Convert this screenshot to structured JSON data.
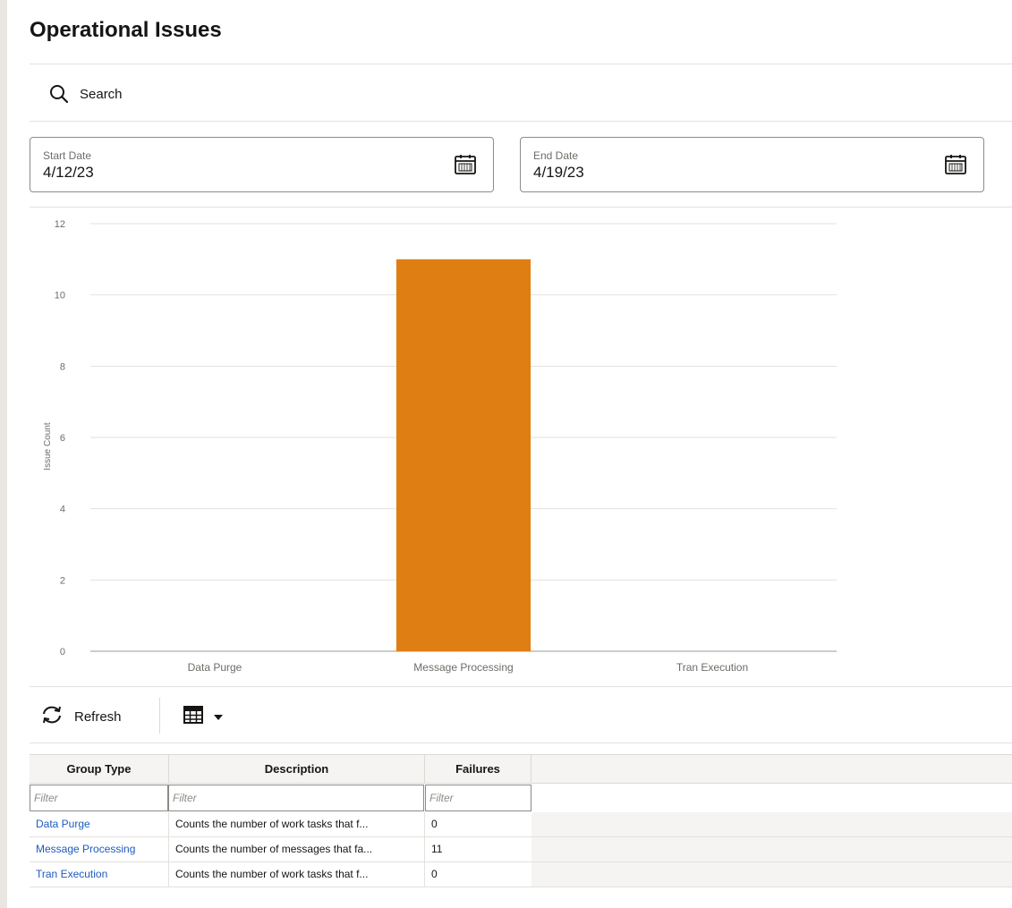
{
  "page": {
    "title": "Operational Issues"
  },
  "search": {
    "label": "Search"
  },
  "filters": {
    "start": {
      "label": "Start Date",
      "value": "4/12/23"
    },
    "end": {
      "label": "End Date",
      "value": "4/19/23"
    }
  },
  "chart_data": {
    "type": "bar",
    "categories": [
      "Data Purge",
      "Message Processing",
      "Tran Execution"
    ],
    "values": [
      0,
      11,
      0
    ],
    "ylabel": "Issue Count",
    "xlabel": "",
    "ylim": [
      0,
      12
    ],
    "yticks": [
      0,
      2,
      4,
      6,
      8,
      10,
      12
    ],
    "grid": true,
    "bar_color": "#df7e13"
  },
  "toolbar": {
    "refresh_label": "Refresh"
  },
  "table": {
    "columns": [
      "Group Type",
      "Description",
      "Failures"
    ],
    "filter_placeholder": "Filter",
    "rows": [
      {
        "group": "Data Purge",
        "description": "Counts the number of work tasks that f...",
        "failures": "0"
      },
      {
        "group": "Message Processing",
        "description": "Counts the number of messages that fa...",
        "failures": "11"
      },
      {
        "group": "Tran Execution",
        "description": "Counts the number of work tasks that f...",
        "failures": "0"
      }
    ]
  },
  "colors": {
    "accent": "#df7e13",
    "link": "#1d5bbf"
  }
}
